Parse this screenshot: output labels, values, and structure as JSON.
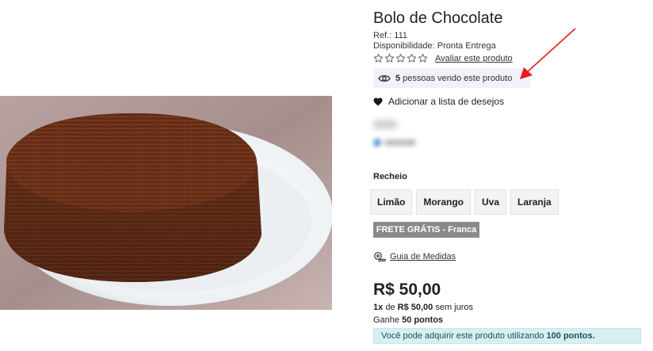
{
  "product": {
    "title": "Bolo de Chocolate",
    "ref_label": "Ref.:",
    "ref_value": "111",
    "availability_label": "Disponibilidade:",
    "availability_value": "Pronta Entrega",
    "rating_stars": 0,
    "rate_link": "Avaliar este produto",
    "viewers_count": "5",
    "viewers_text": "pessoas vendo este produto",
    "wishlist_label": "Adicionar a lista de desejos"
  },
  "filling": {
    "label": "Recheio",
    "options": [
      "Limão",
      "Morango",
      "Uva",
      "Laranja"
    ]
  },
  "shipping_badge": "FRETE GRÁTIS - Franca",
  "size_guide": "Guia de Medidas",
  "pricing": {
    "price": "R$ 50,00",
    "installment_qty": "1x",
    "installment_de": "de",
    "installment_value": "R$ 50,00",
    "installment_suffix": "sem juros",
    "points_prefix": "Ganhe",
    "points_value": "50 pontos",
    "acquire_prefix": "Você pode adquirir este produto utilizando",
    "acquire_points": "100 pontos."
  },
  "icons": {
    "star": "star-outline-icon",
    "eye": "eye-icon",
    "heart": "heart-icon",
    "tape": "measuring-tape-icon"
  },
  "colors": {
    "annotation_arrow": "#e81c1c",
    "viewers_bg": "#f1f0fb",
    "shipping_badge_bg": "#8a8a8a",
    "points_info_bg": "#d6eff3"
  }
}
